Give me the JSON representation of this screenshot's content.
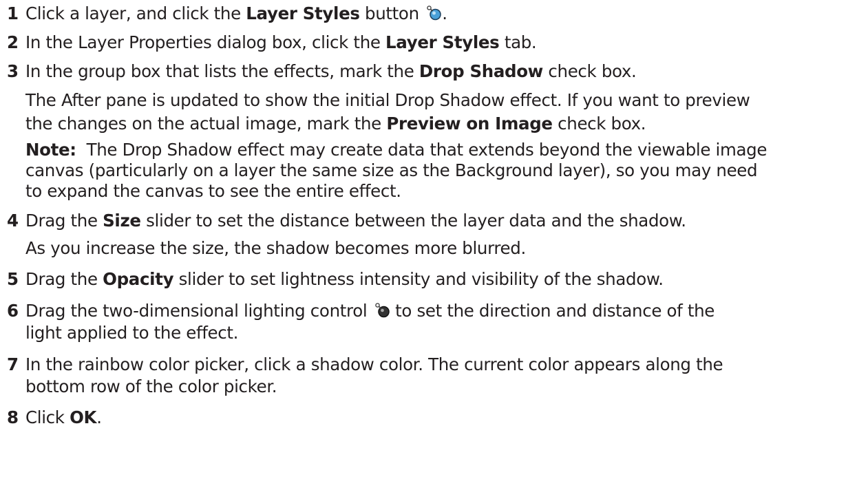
{
  "steps": [
    {
      "number": "1",
      "parts": [
        "Click a layer, and click the ",
        "Layer Styles",
        " button ",
        "."
      ],
      "icon": "layer-styles-icon",
      "icon_color": "#4aa0d8"
    },
    {
      "number": "2",
      "parts": [
        "In the Layer Properties dialog box, click the ",
        "Layer Styles",
        " tab."
      ]
    },
    {
      "number": "3",
      "parts": [
        "In the group box that lists the effects, mark the ",
        "Drop Shadow",
        " check box."
      ],
      "detail_line1": "The After pane is updated to show the initial Drop Shadow effect. If you want to preview",
      "detail_line2_parts": [
        "the changes on the actual image, mark the ",
        "Preview on Image",
        " check box."
      ],
      "note_label": "Note:",
      "note_line1": "The Drop Shadow effect may create data that extends beyond the viewable image",
      "note_line2": "canvas (particularly on a layer the same size as the Background layer), so you may need",
      "note_line3": "to expand the canvas to see the entire effect."
    },
    {
      "number": "4",
      "parts": [
        "Drag the ",
        "Size",
        " slider to set the distance between the layer data and the shadow."
      ],
      "detail": "As you increase the size, the shadow becomes more blurred."
    },
    {
      "number": "5",
      "parts": [
        "Drag the ",
        "Opacity",
        " slider to set lightness intensity and visibility of the shadow."
      ]
    },
    {
      "number": "6",
      "line1_parts": [
        "Drag the two-dimensional lighting control ",
        " to set the direction and distance of the"
      ],
      "line2": "light applied to the effect.",
      "icon": "lighting-control-icon",
      "icon_color": "#333333"
    },
    {
      "number": "7",
      "line1": "In the rainbow color picker, click a shadow color. The current color appears along the",
      "line2": "bottom row of the color picker."
    },
    {
      "number": "8",
      "parts": [
        "Click ",
        "OK",
        "."
      ]
    }
  ]
}
